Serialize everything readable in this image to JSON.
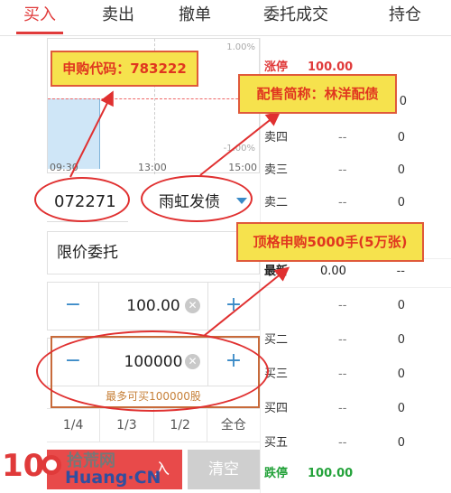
{
  "tabs": [
    "买入",
    "卖出",
    "撤单",
    "委托成交",
    "持仓"
  ],
  "chart": {
    "pct_top": "1.00%",
    "pct_bottom": "-1.00%",
    "times": [
      "09:30",
      "13:00",
      "15:00"
    ]
  },
  "stock": {
    "code": "072271",
    "name": "雨虹发债"
  },
  "order_type": "限价委托",
  "price": {
    "minus": "−",
    "value": "100.00",
    "plus": "+"
  },
  "quantity": {
    "minus": "−",
    "value": "100000",
    "plus": "+"
  },
  "clear_glyph": "✕",
  "hint": "最多可买100000股",
  "fractions": [
    "1/4",
    "1/3",
    "1/2",
    "全仓"
  ],
  "buttons": {
    "buy": "入",
    "clear": "清空"
  },
  "book": {
    "limit_up": {
      "label": "涨停",
      "price": "100.00"
    },
    "sells": [
      {
        "label": "卖四",
        "price": "--",
        "vol": "0"
      },
      {
        "label": "卖三",
        "price": "--",
        "vol": "0"
      },
      {
        "label": "卖二",
        "price": "--",
        "vol": "0"
      }
    ],
    "latest": {
      "label": "最新",
      "price": "0.00",
      "vol": "--"
    },
    "buys": [
      {
        "label": "",
        "price": "--",
        "vol": "0"
      },
      {
        "label": "买二",
        "price": "--",
        "vol": "0"
      },
      {
        "label": "买三",
        "price": "--",
        "vol": "0"
      },
      {
        "label": "买四",
        "price": "--",
        "vol": "0"
      },
      {
        "label": "买五",
        "price": "--",
        "vol": "0"
      }
    ],
    "limit_down": {
      "label": "跌停",
      "price": "100.00"
    },
    "hidden_vol": "0"
  },
  "annotations": {
    "purchase_code": "申购代码：783222",
    "placement_name": "配售简称：林洋配债",
    "max_purchase": "顶格申购5000手(5万张)"
  },
  "watermark": {
    "num": "10",
    "cn": "拾荒网",
    "en": "Huang·CN"
  },
  "colors": {
    "accent_red": "#e03a3a",
    "blue": "#3a8ac7",
    "green": "#23a23a",
    "callout_bg": "#f6e24d"
  }
}
